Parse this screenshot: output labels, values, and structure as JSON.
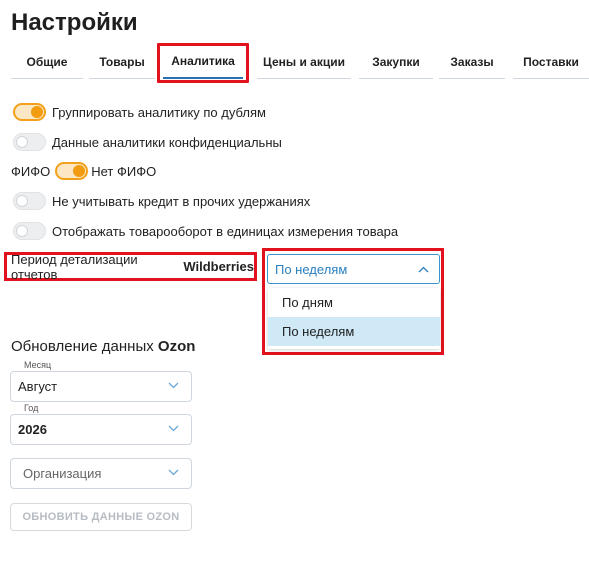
{
  "page": {
    "title": "Настройки"
  },
  "tabs": [
    {
      "label": "Общие"
    },
    {
      "label": "Товары"
    },
    {
      "label": "Аналитика"
    },
    {
      "label": "Цены и акции"
    },
    {
      "label": "Закупки"
    },
    {
      "label": "Заказы"
    },
    {
      "label": "Поставки"
    }
  ],
  "active_tab": "Аналитика",
  "settings": {
    "group_by_duplicates": {
      "label": "Группировать аналитику по дублям",
      "on": true
    },
    "confidential": {
      "label": "Данные аналитики конфиденциальны",
      "on": false
    },
    "fifo": {
      "left_label": "ФИФО",
      "right_label": "Нет ФИФО",
      "on": true
    },
    "ignore_credit": {
      "label": "Не учитывать кредит в прочих удержаниях",
      "on": false
    },
    "turnover_units": {
      "label": "Отображать товарооборот в единицах измерения товара",
      "on": false
    }
  },
  "period": {
    "label_prefix": "Период детализации отчетов",
    "label_brand": "Wildberries",
    "selected": "По неделям",
    "options": [
      "По дням",
      "По неделям"
    ]
  },
  "ozon": {
    "title_prefix": "Обновление данных",
    "title_brand": "Ozon",
    "month_caption": "Месяц",
    "month_value": "Август",
    "year_caption": "Год",
    "year_value": "2026",
    "org_placeholder": "Организация",
    "update_button": "ОБНОВИТЬ ДАННЫЕ OZON"
  },
  "colors": {
    "accent": "#f39c12",
    "link": "#2a7fc0",
    "highlight": "#e1121d",
    "selected_option_bg": "#cfe9f7"
  }
}
